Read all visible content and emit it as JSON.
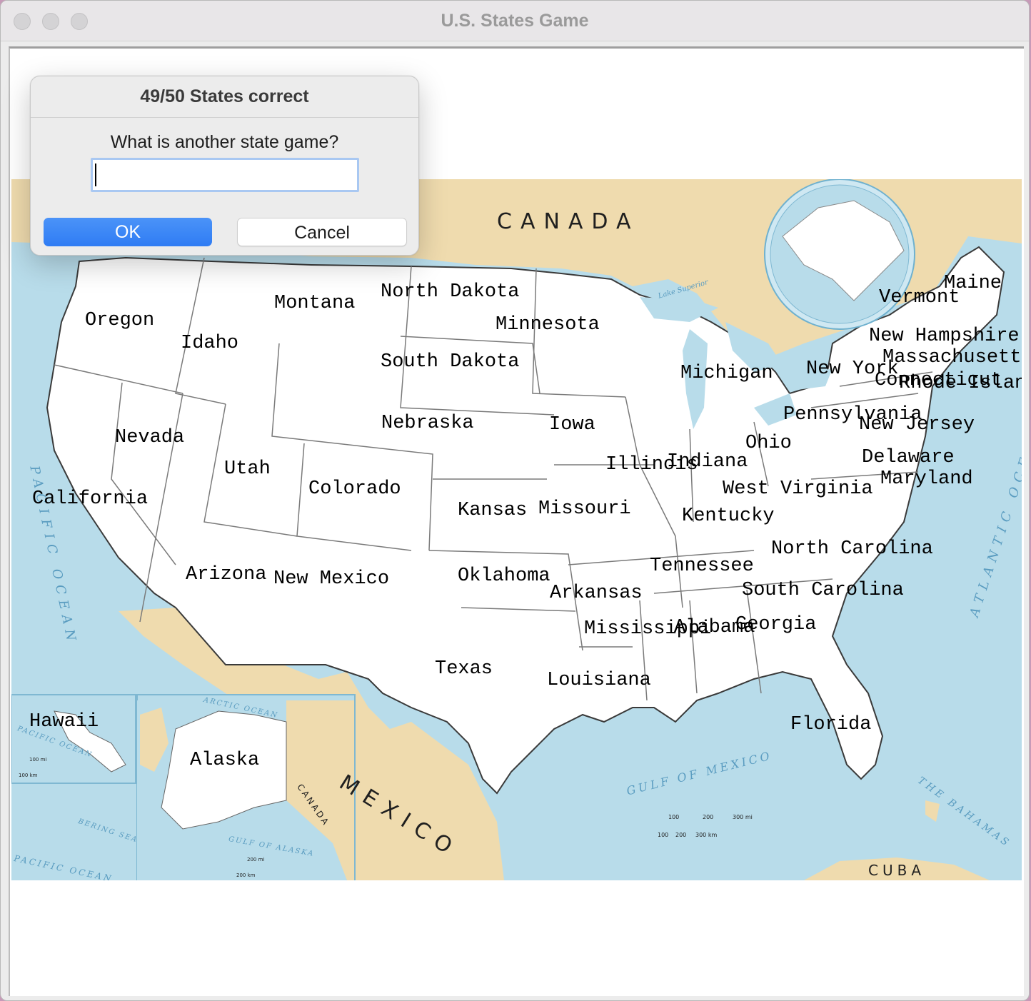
{
  "window": {
    "title": "U.S. States Game"
  },
  "dialog": {
    "title": "49/50 States correct",
    "prompt": "What is another state game?",
    "input_value": "",
    "ok_label": "OK",
    "cancel_label": "Cancel"
  },
  "map": {
    "country_labels": [
      "CANADA",
      "MEXICO",
      "CANADA",
      "CUBA"
    ],
    "water_labels": [
      "PACIFIC OCEAN",
      "ATLANTIC OCEAN",
      "GULF OF MEXICO",
      "THE BAHAMAS",
      "ARCTIC OCEAN",
      "BERING SEA",
      "GULF OF ALASKA",
      "PACIFIC OCEAN",
      "PACIFIC OCEAN",
      "Lake Superior"
    ],
    "scale_labels": [
      "100 mi",
      "100 km",
      "200 mi",
      "200 km",
      "100",
      "200",
      "300 mi",
      "100",
      "200",
      "300 km"
    ],
    "states": [
      "Oregon",
      "Idaho",
      "Montana",
      "North Dakota",
      "Minnesota",
      "South Dakota",
      "Michigan",
      "New York",
      "Maine",
      "Vermont",
      "New Hampshire",
      "Massachusetts",
      "Connecticut",
      "Rhode Island",
      "Pennsylvania",
      "New Jersey",
      "Delaware",
      "Maryland",
      "Nevada",
      "Utah",
      "California",
      "Colorado",
      "Nebraska",
      "Iowa",
      "Illinois",
      "Indiana",
      "Ohio",
      "West Virginia",
      "Kansas",
      "Missouri",
      "Kentucky",
      "Arizona",
      "New Mexico",
      "Oklahoma",
      "Arkansas",
      "Tennessee",
      "North Carolina",
      "South Carolina",
      "Mississippi",
      "Alabama",
      "Georgia",
      "Texas",
      "Louisiana",
      "Florida",
      "Hawaii",
      "Alaska"
    ]
  },
  "colors": {
    "water": "#b8dcea",
    "foreign_land": "#efdbae",
    "us_land": "#ffffff",
    "accent": "#3583f6"
  }
}
